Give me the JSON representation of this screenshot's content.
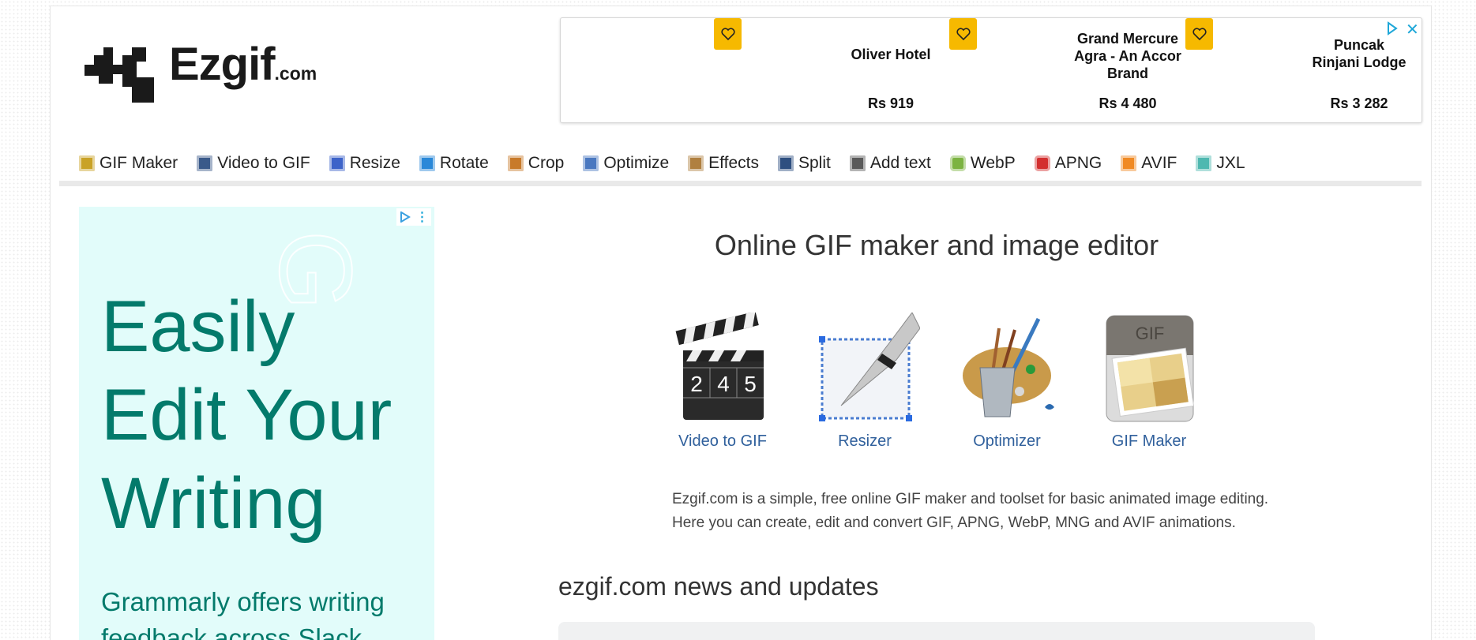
{
  "logo": {
    "name": "Ezgif",
    "suffix": ".com"
  },
  "top_ad": {
    "hotels": [
      {
        "name": "Oliver Hotel",
        "price": "Rs 919"
      },
      {
        "name": "Grand Mercure Agra - An Accor Brand",
        "price": "Rs 4 480"
      },
      {
        "name": "Puncak Rinjani Lodge",
        "price": "Rs 3 282"
      }
    ]
  },
  "nav": [
    {
      "label": "GIF Maker",
      "color": "#c9a227"
    },
    {
      "label": "Video to GIF",
      "color": "#3a5a8a"
    },
    {
      "label": "Resize",
      "color": "#3d63c9"
    },
    {
      "label": "Rotate",
      "color": "#2a88d8"
    },
    {
      "label": "Crop",
      "color": "#c87a2a"
    },
    {
      "label": "Optimize",
      "color": "#4a78c0"
    },
    {
      "label": "Effects",
      "color": "#b08040"
    },
    {
      "label": "Split",
      "color": "#2e4f80"
    },
    {
      "label": "Add text",
      "color": "#5a5a5a"
    },
    {
      "label": "WebP",
      "color": "#7cb342"
    },
    {
      "label": "APNG",
      "color": "#d32f2f"
    },
    {
      "label": "AVIF",
      "color": "#f08a24"
    },
    {
      "label": "JXL",
      "color": "#4fb8b0"
    }
  ],
  "left_ad": {
    "headline": [
      "Easily",
      "Edit Your",
      "Writing"
    ],
    "sub": [
      "Grammarly offers writing",
      "feedback across Slack"
    ]
  },
  "main": {
    "title": "Online GIF maker and image editor",
    "tools": [
      {
        "label": "Video to GIF"
      },
      {
        "label": "Resizer"
      },
      {
        "label": "Optimizer"
      },
      {
        "label": "GIF Maker"
      }
    ],
    "clapper_numbers": [
      "2",
      "4",
      "5"
    ],
    "gif_badge": "GIF",
    "description": [
      "Ezgif.com is a simple, free online GIF maker and toolset for basic animated image editing.",
      "Here you can create, edit and convert GIF, APNG, WebP, MNG and AVIF animations."
    ],
    "news_heading": "ezgif.com news and updates"
  }
}
